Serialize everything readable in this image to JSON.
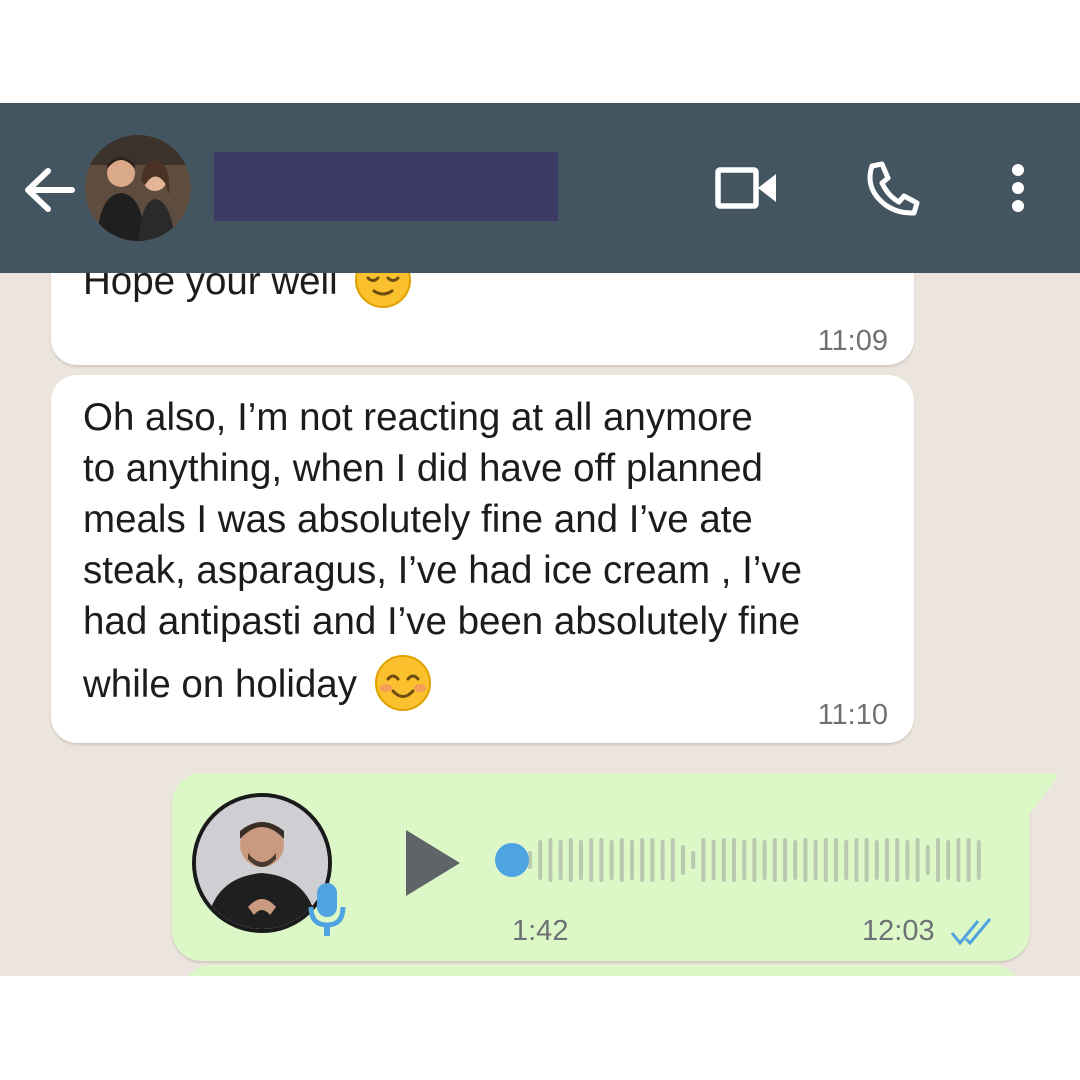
{
  "header": {
    "back_icon": "arrow-left-icon",
    "contact_name": "",
    "actions": [
      "video-call-icon",
      "phone-icon",
      "more-vertical-icon"
    ]
  },
  "messages": [
    {
      "direction": "incoming",
      "text_lines": [
        "Hope your well"
      ],
      "emoji": "relieved-face",
      "time": "11:09"
    },
    {
      "direction": "incoming",
      "text_lines": [
        "Oh also, I’m not reacting at all anymore",
        "to anything, when I did have off planned",
        "meals I was absolutely fine and I’ve ate",
        "steak, asparagus, I’ve had ice cream , I’ve",
        "had antipasti and I’ve been absolutely fine",
        "while on holiday"
      ],
      "emoji": "smiling-face-with-smiling-eyes",
      "time": "11:10"
    },
    {
      "direction": "outgoing",
      "type": "voice",
      "duration": "1:42",
      "time": "12:03",
      "status": "read",
      "progress": 0
    }
  ],
  "colors": {
    "header": "#435561",
    "chat_background": "#ece5dd",
    "incoming_bubble": "#ffffff",
    "outgoing_bubble": "#dcf8c6",
    "read_ticks": "#4fc3f7"
  }
}
